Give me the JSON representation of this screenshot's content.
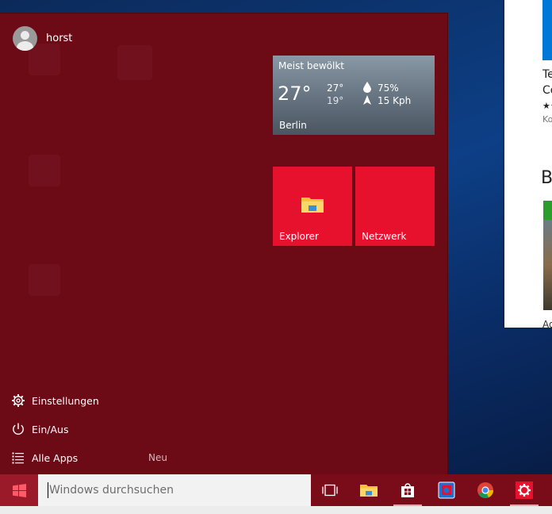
{
  "user": {
    "name": "horst"
  },
  "left_menu": {
    "settings": "Einstellungen",
    "power": "Ein/Aus",
    "all_apps": "Alle Apps",
    "new_badge": "Neu"
  },
  "weather": {
    "condition": "Meist bewölkt",
    "temperature": "27°",
    "high": "27°",
    "low": "19°",
    "humidity": "75%",
    "wind": "15 Kph",
    "city": "Berlin"
  },
  "tiles": {
    "explorer": "Explorer",
    "network": "Netzwerk"
  },
  "search": {
    "placeholder": "Windows durchsuchen"
  },
  "store_window": {
    "line1": "Te",
    "line2": "Co",
    "stars": "★★",
    "line3": "Ko",
    "heading": "B",
    "bottom": "Ad"
  },
  "colors": {
    "start_menu": "#6c0a16",
    "tile_red": "#e8112d",
    "taskbar": "#7a0c19"
  },
  "icons": {
    "start": "windows-logo-icon",
    "task_view": "task-view-icon",
    "explorer": "folder-icon",
    "store": "store-bag-icon",
    "app": "blue-app-icon",
    "chrome": "chrome-icon",
    "settings": "gear-icon"
  }
}
